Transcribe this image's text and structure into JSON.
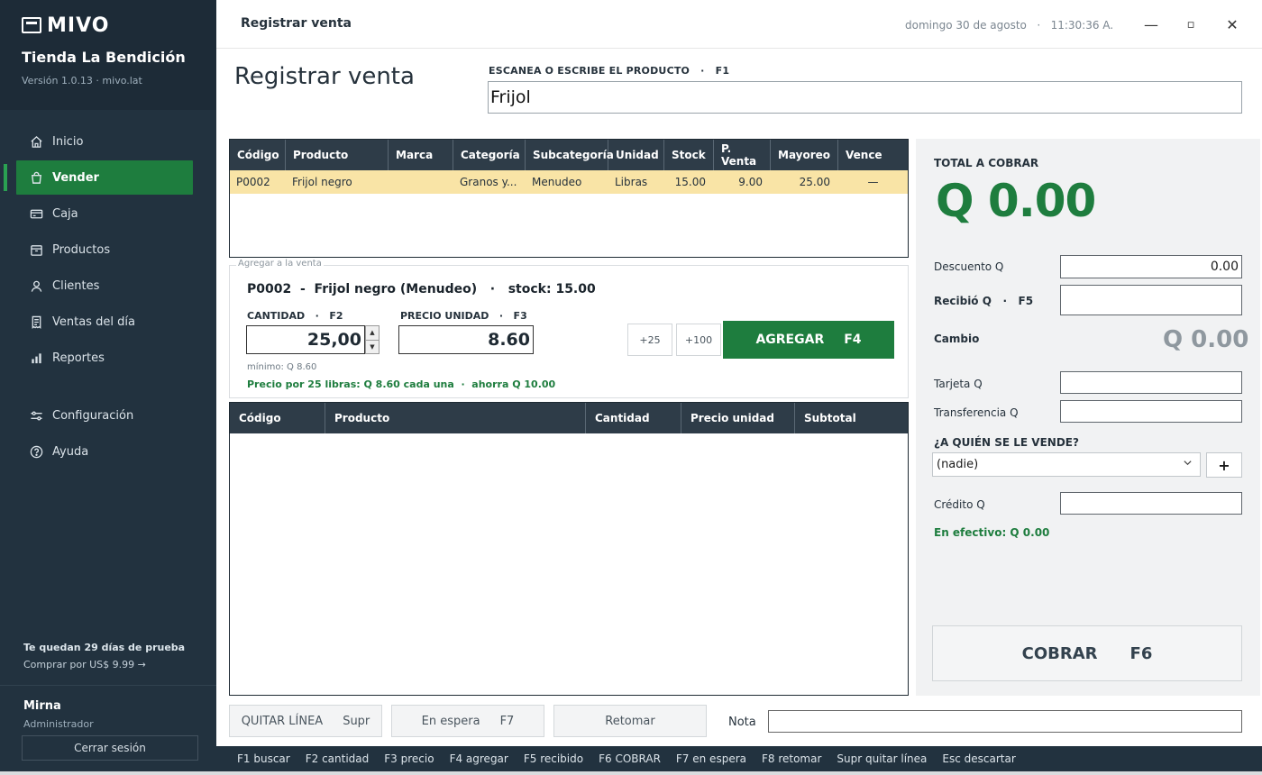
{
  "brand": {
    "logo_text": "MIVO",
    "store_name": "Tienda La Bendición",
    "version": "Versión 1.0.13 · mivo.lat"
  },
  "nav": [
    {
      "label": "Inicio",
      "icon": "home-icon"
    },
    {
      "label": "Vender",
      "icon": "shopping-bag-icon",
      "active": true
    },
    {
      "label": "Caja",
      "icon": "cash-register-icon"
    },
    {
      "label": "Productos",
      "icon": "box-icon"
    },
    {
      "label": "Clientes",
      "icon": "user-icon"
    },
    {
      "label": "Ventas del día",
      "icon": "receipt-icon"
    },
    {
      "label": "Reportes",
      "icon": "bar-chart-icon"
    },
    {
      "label": "Configuración",
      "icon": "sliders-icon"
    },
    {
      "label": "Ayuda",
      "icon": "help-circle-icon"
    }
  ],
  "trial": {
    "days_left": "Te quedan 29 días de prueba",
    "buy": "Comprar por US$ 9.99 →"
  },
  "user": {
    "name": "Mirna",
    "role": "Administrador",
    "logout": "Cerrar sesión"
  },
  "window": {
    "title": "Registrar venta",
    "datetime": "domingo 30 de agosto   ·   11:30:36 A.",
    "minimize": "—",
    "maximize": "▫",
    "close": "✕"
  },
  "page": {
    "title": "Registrar venta",
    "scan_label": "ESCANEA O ESCRIBE EL PRODUCTO   ·   F1",
    "scan_value": "Frijol"
  },
  "product_table": {
    "headers": [
      "Código",
      "Producto",
      "Marca",
      "Categoría",
      "Subcategoría",
      "Unidad",
      "Stock",
      "P. Venta",
      "Mayoreo",
      "Vence"
    ],
    "rows": [
      [
        "P0002",
        "Frijol negro",
        "",
        "Granos y...",
        "Menudeo",
        "Libras",
        "15.00",
        "9.00",
        "25.00",
        "—"
      ]
    ]
  },
  "add": {
    "legend": "Agregar a la venta",
    "title": "P0002  -  Frijol negro (Menudeo)   ·   stock: 15.00",
    "qty_label": "CANTIDAD   ·   F2",
    "qty_value": "25,00",
    "price_label": "PRECIO UNIDAD   ·   F3",
    "price_value": "8.60",
    "min_note": "mínimo: Q 8.60",
    "promo_note": "Precio por 25 libras: Q 8.60 cada una  ·  ahorra Q 10.00",
    "quick1": "+25",
    "quick2": "+100",
    "add_label": "AGREGAR",
    "add_key": "F4"
  },
  "cart_table": {
    "headers": [
      "Código",
      "Producto",
      "Cantidad",
      "Precio unidad",
      "Subtotal"
    ]
  },
  "bottom": {
    "remove_label": "QUITAR LÍNEA",
    "remove_key": "Supr",
    "hold_label": "En espera",
    "hold_key": "F7",
    "resume_label": "Retomar",
    "nota_label": "Nota",
    "nota_value": ""
  },
  "shortcuts": [
    "F1 buscar",
    "F2 cantidad",
    "F3 precio",
    "F4 agregar",
    "F5 recibido",
    "F6 COBRAR",
    "F7 en espera",
    "F8 retomar",
    "Supr quitar línea",
    "Esc descartar"
  ],
  "payment": {
    "total_label": "TOTAL A COBRAR",
    "total_value": "Q 0.00",
    "descuento_label": "Descuento Q",
    "descuento_value": "0.00",
    "recibio_label": "Recibió Q   ·   F5",
    "recibio_value": "",
    "cambio_label": "Cambio",
    "cambio_value": "Q 0.00",
    "tarjeta_label": "Tarjeta Q",
    "tarjeta_value": "",
    "transferencia_label": "Transferencia Q",
    "transferencia_value": "",
    "quien_label": "¿A QUIÉN SE LE VENDE?",
    "customer_selected": "(nadie)",
    "add_customer": "+",
    "credito_label": "Crédito Q",
    "credito_value": "",
    "efectivo": "En efectivo: Q 0.00",
    "cobrar_label": "COBRAR",
    "cobrar_key": "F6"
  },
  "colors": {
    "sidebar": "#22323f",
    "accent": "#1e7d3e",
    "table_header": "#2e3c48",
    "selected_row": "#f9e4a6"
  }
}
